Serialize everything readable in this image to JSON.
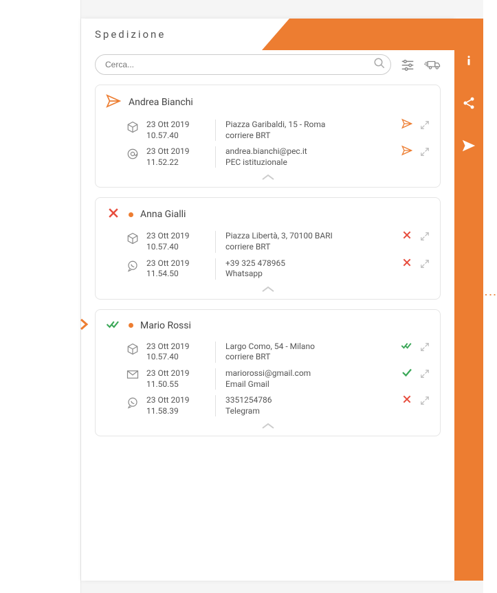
{
  "title": "Spedizione",
  "search": {
    "placeholder": "Cerca..."
  },
  "shipments": [
    {
      "status": "sent",
      "name": "Andrea Bianchi",
      "rows": [
        {
          "type": "box",
          "date": "23 Ott 2019",
          "time": "10.57.40",
          "line1": "Piazza Garibaldi, 15 - Roma",
          "line2": "corriere BRT",
          "status": "sent"
        },
        {
          "type": "at",
          "date": "23 Ott 2019",
          "time": "11.52.22",
          "line1": "andrea.bianchi@pec.it",
          "line2": "PEC istituzionale",
          "status": "sent"
        }
      ]
    },
    {
      "status": "fail",
      "name": "Anna Gialli",
      "rows": [
        {
          "type": "box",
          "date": "23 Ott 2019",
          "time": "10.57.40",
          "line1": "Piazza Libertà, 3, 70100 BARI",
          "line2": "corriere BRT",
          "status": "fail"
        },
        {
          "type": "whatsapp",
          "date": "23 Ott 2019",
          "time": "11.54.50",
          "line1": "+39 325 478965",
          "line2": "Whatsapp",
          "status": "fail"
        }
      ]
    },
    {
      "status": "ok",
      "name": "Mario Rossi",
      "indicator": true,
      "rows": [
        {
          "type": "box",
          "date": "23 Ott 2019",
          "time": "10.57.40",
          "line1": "Largo Como, 54 - Milano",
          "line2": "corriere BRT",
          "status": "ok"
        },
        {
          "type": "mail",
          "date": "23 Ott 2019",
          "time": "11.50.55",
          "line1": "mariorossi@gmail.com",
          "line2": "Email Gmail",
          "status": "check"
        },
        {
          "type": "whatsapp",
          "date": "23 Ott 2019",
          "time": "11.58.39",
          "line1": "3351254786",
          "line2": "Telegram",
          "status": "fail"
        }
      ]
    }
  ]
}
